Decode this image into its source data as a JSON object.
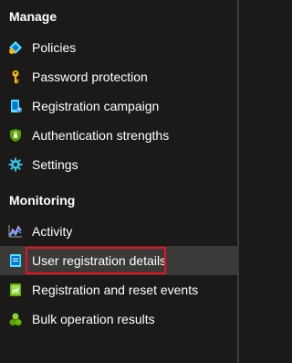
{
  "sections": {
    "manage": {
      "title": "Manage",
      "items": [
        {
          "label": "Policies",
          "icon": "policies-icon"
        },
        {
          "label": "Password protection",
          "icon": "key-icon"
        },
        {
          "label": "Registration campaign",
          "icon": "registration-campaign-icon"
        },
        {
          "label": "Authentication strengths",
          "icon": "shield-icon"
        },
        {
          "label": "Settings",
          "icon": "gear-icon"
        }
      ]
    },
    "monitoring": {
      "title": "Monitoring",
      "items": [
        {
          "label": "Activity",
          "icon": "activity-chart-icon"
        },
        {
          "label": "User registration details",
          "icon": "user-details-icon",
          "selected": true
        },
        {
          "label": "Registration and reset events",
          "icon": "events-log-icon"
        },
        {
          "label": "Bulk operation results",
          "icon": "bulk-operations-icon"
        }
      ]
    }
  },
  "colors": {
    "background": "#1b1a19",
    "selected_background": "#3b3a39",
    "highlight_border": "#e81123",
    "text": "#ffffff"
  }
}
